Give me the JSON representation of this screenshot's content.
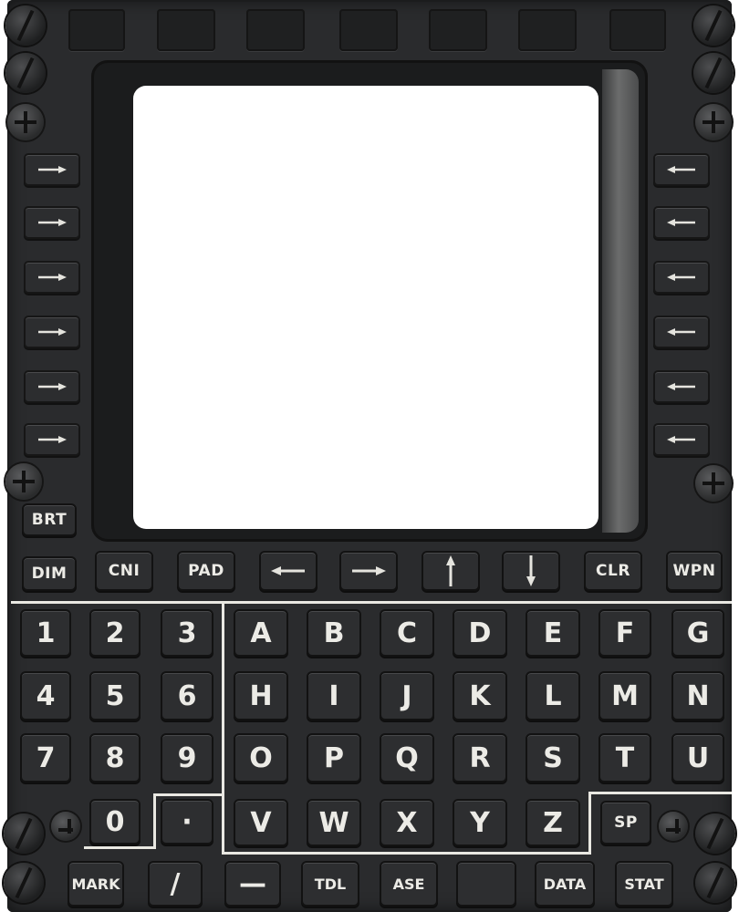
{
  "panel": {
    "top_buttons_count": 7,
    "line_select_keys": {
      "left": [
        "arrow-right",
        "arrow-right",
        "arrow-right",
        "arrow-right",
        "arrow-right",
        "arrow-right"
      ],
      "right": [
        "arrow-left",
        "arrow-left",
        "arrow-left",
        "arrow-left",
        "arrow-left",
        "arrow-left"
      ]
    },
    "brightness": {
      "brt": "BRT",
      "dim": "DIM"
    },
    "function_row": [
      {
        "label": "CNI",
        "icon": null
      },
      {
        "label": "PAD",
        "icon": null
      },
      {
        "label": "",
        "icon": "arrow-left-icon"
      },
      {
        "label": "",
        "icon": "arrow-right-icon"
      },
      {
        "label": "",
        "icon": "arrow-up-icon"
      },
      {
        "label": "",
        "icon": "arrow-down-icon"
      },
      {
        "label": "CLR",
        "icon": null
      },
      {
        "label": "WPN",
        "icon": null
      }
    ],
    "numeric_keys": [
      "1",
      "2",
      "3",
      "4",
      "5",
      "6",
      "7",
      "8",
      "9",
      "0",
      "·"
    ],
    "alpha_keys": [
      "A",
      "B",
      "C",
      "D",
      "E",
      "F",
      "G",
      "H",
      "I",
      "J",
      "K",
      "L",
      "M",
      "N",
      "O",
      "P",
      "Q",
      "R",
      "S",
      "T",
      "U",
      "V",
      "W",
      "X",
      "Y",
      "Z"
    ],
    "sp": "SP",
    "bottom_row": [
      "MARK",
      "/",
      "—",
      "TDL",
      "ASE",
      "",
      "DATA",
      "STAT"
    ],
    "colors": {
      "panel": "#2a2b2d",
      "legend": "#ecebe6",
      "screen": "#ffffff",
      "divider": "#e9e8e2"
    }
  }
}
